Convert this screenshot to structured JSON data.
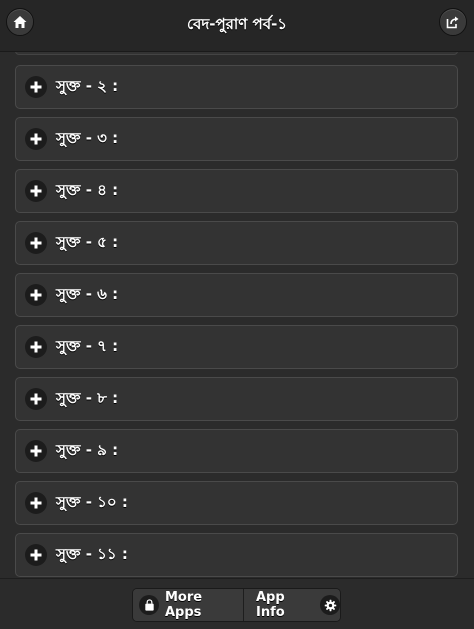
{
  "header": {
    "title": "বেদ-পুরাণ পর্ব-১",
    "home_icon": "home-icon",
    "share_icon": "share-icon"
  },
  "list": {
    "items": [
      {
        "label": "সুক্ত - ২ :"
      },
      {
        "label": "সুক্ত - ৩ :"
      },
      {
        "label": "সুক্ত - ৪ :"
      },
      {
        "label": "সুক্ত - ৫ :"
      },
      {
        "label": "সুক্ত - ৬ :"
      },
      {
        "label": "সুক্ত - ৭ :"
      },
      {
        "label": "সুক্ত - ৮ :"
      },
      {
        "label": "সুক্ত - ৯ :"
      },
      {
        "label": "সুক্ত - ১০ :"
      },
      {
        "label": "সুক্ত - ১১ :"
      }
    ]
  },
  "footer": {
    "more_apps_label": "More Apps",
    "app_info_label": "App Info"
  }
}
